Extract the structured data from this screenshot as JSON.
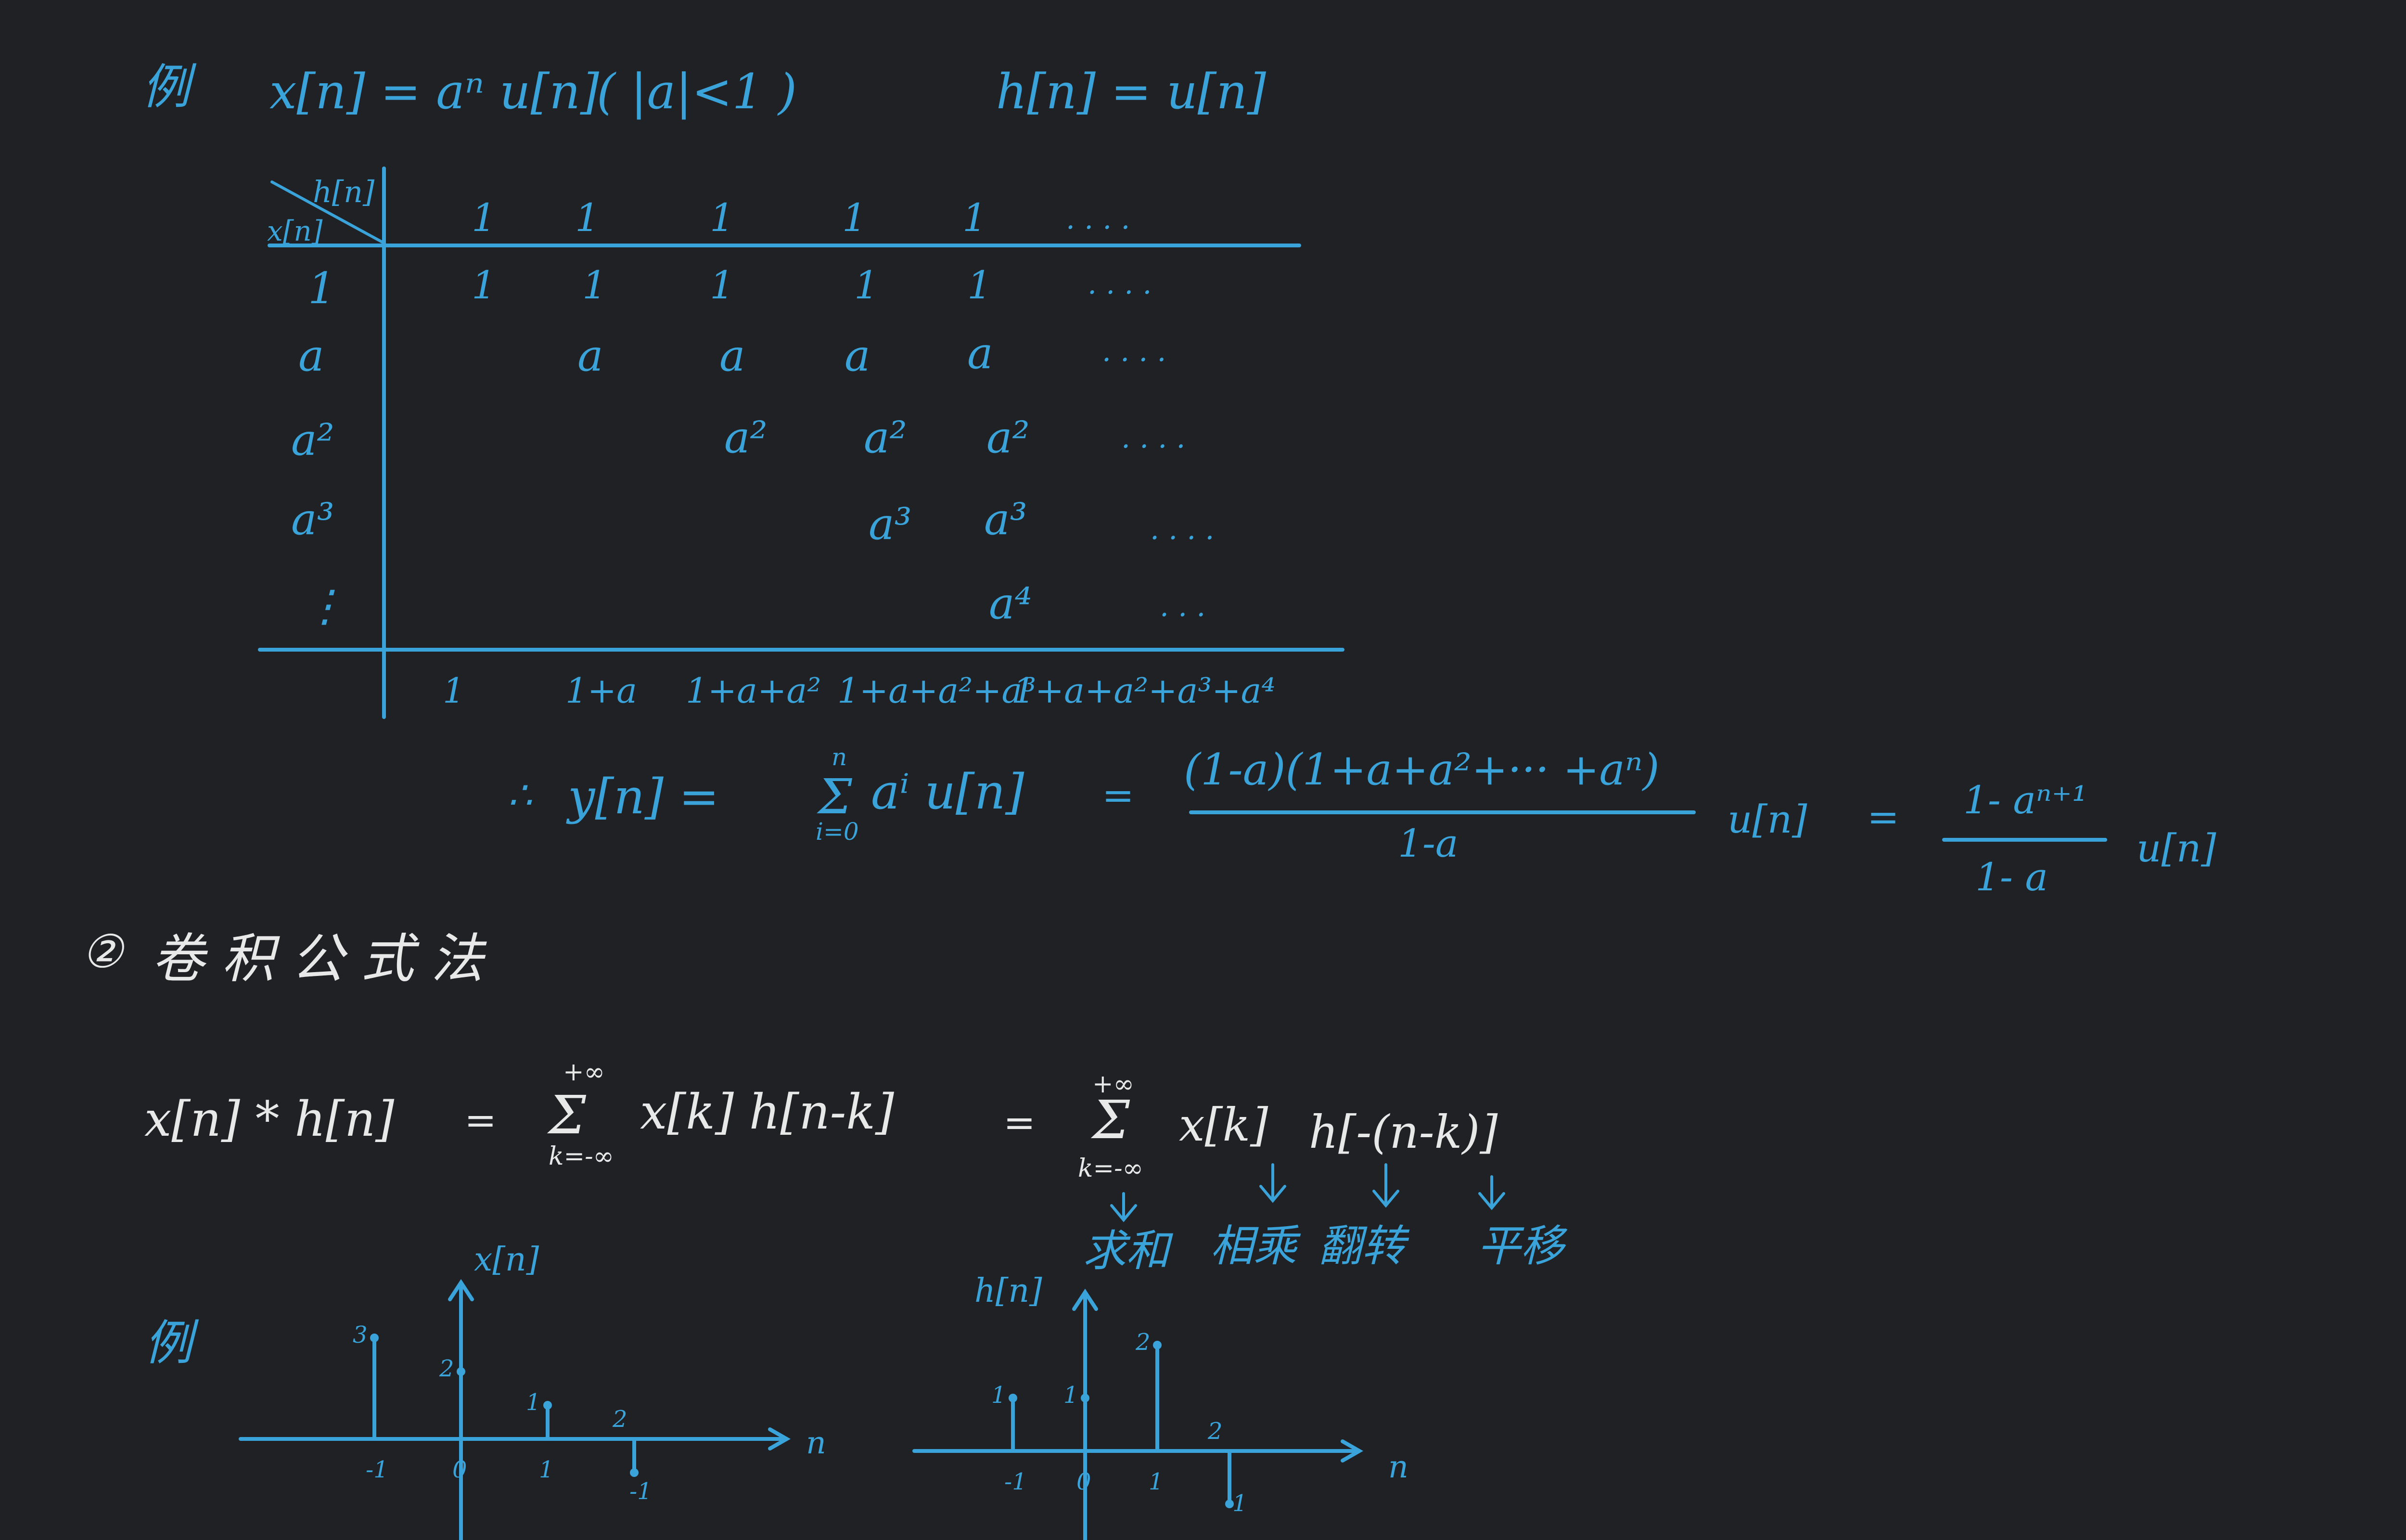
{
  "colors": {
    "background": "#1f2125",
    "ink_blue": "#3aa3d9",
    "ink_white": "#e8e8e8"
  },
  "example1": {
    "label": "例",
    "x_def": "x[n] = aⁿ u[n]",
    "x_cond": "( |a|<1 )",
    "h_def": "h[n] = u[n]"
  },
  "table": {
    "corner_h": "h[n]",
    "corner_x": "x[n]",
    "header": [
      "1",
      "1",
      "1",
      "1",
      "1",
      ". . . ."
    ],
    "row_labels": [
      "1",
      "a",
      "a²",
      "a³",
      "⋮"
    ],
    "rows": [
      [
        "1",
        "1",
        "1",
        "1",
        "1",
        ". . . ."
      ],
      [
        "a",
        "a",
        "a",
        "a",
        ". . . ."
      ],
      [
        "a²",
        "a²",
        "a²",
        ". . . ."
      ],
      [
        "a³",
        "a³",
        ". . . ."
      ],
      [
        "a⁴",
        ". . ."
      ]
    ],
    "sums": [
      "1",
      "1+a",
      "1+a+a²",
      "1+a+a²+a³",
      "1+a+a²+a³+a⁴"
    ]
  },
  "result": {
    "therefore": "∴",
    "lhs": "y[n] =",
    "sum_top": "n",
    "sum_symbol": "Σ",
    "sum_bottom": "i=0",
    "sum_term": "aⁱ u[n]",
    "eq1": "=",
    "frac1_num": "(1-a)(1+a+a²+··· +aⁿ)",
    "frac1_den": "1-a",
    "frac1_tail": "u[n]",
    "eq2": "=",
    "frac2_num": "1- aⁿ⁺¹",
    "frac2_den": "1- a",
    "frac2_tail": "u[n]"
  },
  "section2": {
    "number": "②",
    "title": "卷 积 公 式 法"
  },
  "formula": {
    "lhs": "x[n] * h[n]",
    "eq1": "=",
    "sum1_top": "+∞",
    "sum1_symbol": "Σ",
    "sum1_bottom": "k=-∞",
    "term1": "x[k] h[n-k]",
    "eq2": "=",
    "sum2_top": "+∞",
    "sum2_symbol": "Σ",
    "sum2_bottom": "k=-∞",
    "term2a": "x[k]",
    "term2b": "h[-(n-k)]",
    "ann_sum": "求和",
    "ann_mult": "相乘",
    "ann_flip": "翻转",
    "ann_shift": "平移"
  },
  "example2": {
    "label": "例",
    "plot_x": {
      "title": "x[n]",
      "axis": "n",
      "samples": [
        {
          "n": -1,
          "v": 3,
          "value_label": "3"
        },
        {
          "n": 0,
          "v": 2,
          "value_label": "2"
        },
        {
          "n": 1,
          "v": 1,
          "value_label": "1"
        },
        {
          "n": 2,
          "v": -1,
          "value_label": "2"
        }
      ],
      "tick_labels": [
        "-1",
        "0",
        "1"
      ],
      "neg_label": "-1"
    },
    "plot_h": {
      "title": "h[n]",
      "axis": "n",
      "samples": [
        {
          "n": -1,
          "v": 1,
          "value_label": "1"
        },
        {
          "n": 0,
          "v": 1,
          "value_label": "1"
        },
        {
          "n": 1,
          "v": 2,
          "value_label": "2"
        },
        {
          "n": 2,
          "v": -1,
          "value_label": "2"
        }
      ],
      "tick_labels": [
        "-1",
        "0",
        "1"
      ],
      "neg_label": "-1"
    }
  }
}
